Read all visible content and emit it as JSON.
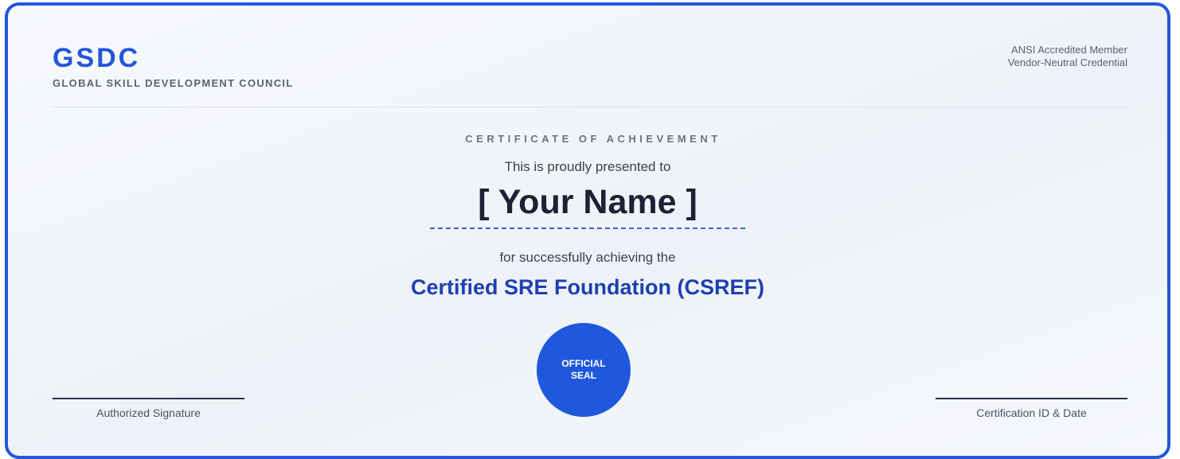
{
  "brand": {
    "name": "GSDC",
    "subtitle": "GLOBAL SKILL DEVELOPMENT COUNCIL"
  },
  "accreditation": {
    "line1": "ANSI Accredited Member",
    "line2": "Vendor-Neutral Credential"
  },
  "certificate": {
    "type": "CERTIFICATE OF ACHIEVEMENT",
    "presented_text": "This is proudly presented to",
    "recipient_name": "[ Your Name ]",
    "achieving_text": "for successfully achieving the",
    "program": "Certified SRE Foundation (CSREF)"
  },
  "seal": {
    "label": "OFFICIAL SEAL"
  },
  "signatures": {
    "left_label": "Authorized Signature",
    "right_label": "Certification ID & Date"
  },
  "colors": {
    "accent": "#2357d9",
    "program": "#1e40af",
    "seal": "#1f58dd"
  }
}
